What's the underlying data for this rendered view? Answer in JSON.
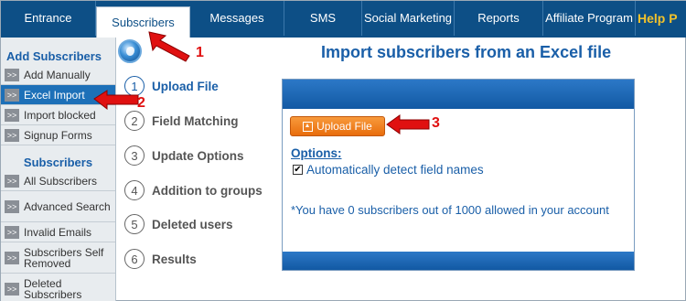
{
  "nav": {
    "items": [
      {
        "label": "Entrance"
      },
      {
        "label": "Subscribers"
      },
      {
        "label": "Messages"
      },
      {
        "label": "SMS"
      },
      {
        "label": "Social Marketing"
      },
      {
        "label": "Reports"
      },
      {
        "label": "Affiliate Program"
      }
    ],
    "help": "Help P"
  },
  "sidebar": {
    "heading1": "Add Subscribers",
    "group1": [
      "Add Manually",
      "Excel Import",
      "Import blocked",
      "Signup Forms"
    ],
    "heading2": "Subscribers",
    "group2": [
      "All Subscribers",
      "Advanced Search",
      "Invalid Emails",
      "Subscribers Self Removed",
      "Deleted Subscribers"
    ],
    "bullet": ">>"
  },
  "page": {
    "title": "Import subscribers from an Excel file"
  },
  "steps": [
    {
      "num": "1",
      "label": "Upload File"
    },
    {
      "num": "2",
      "label": "Field Matching"
    },
    {
      "num": "3",
      "label": "Update Options"
    },
    {
      "num": "4",
      "label": "Addition to groups"
    },
    {
      "num": "5",
      "label": "Deleted users"
    },
    {
      "num": "6",
      "label": "Results"
    }
  ],
  "panel": {
    "upload_label": "Upload File",
    "options_label": "Options:",
    "checkbox_label": "Automatically detect field names",
    "checkbox_checked": true,
    "note": "*You have 0 subscribers out of 1000 allowed in your account"
  },
  "annotations": [
    "1",
    "2",
    "3"
  ],
  "colors": {
    "nav": "#0d4f86",
    "accent": "#1a5fa8",
    "annotation": "#e01010",
    "button": "#e86d0c"
  }
}
